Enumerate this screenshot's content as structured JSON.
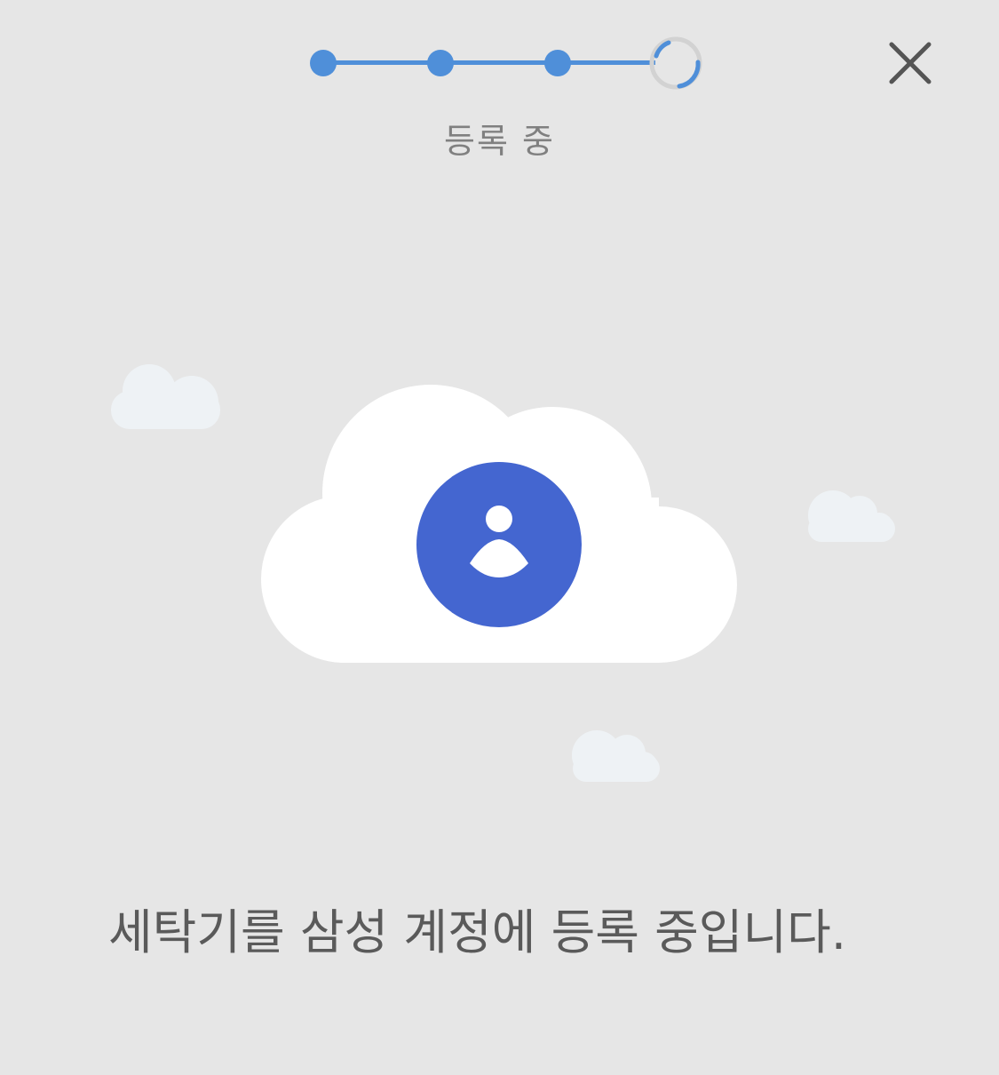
{
  "progress": {
    "label": "등록 중",
    "completed_steps": 3,
    "total_steps": 4,
    "current_step_state": "in-progress"
  },
  "header": {
    "close_icon": "close-icon"
  },
  "illustration": {
    "main_icon": "account-icon",
    "cloud_icon": "cloud-icon"
  },
  "message": {
    "text": "세탁기를 삼성 계정에 등록 중입니다."
  },
  "colors": {
    "background": "#e6e6e6",
    "accent": "#4f8fd9",
    "account_circle": "#4466d0",
    "cloud_main": "#ffffff",
    "cloud_small": "#eef2f5",
    "text": "#5a5a5a",
    "label": "#808080"
  }
}
